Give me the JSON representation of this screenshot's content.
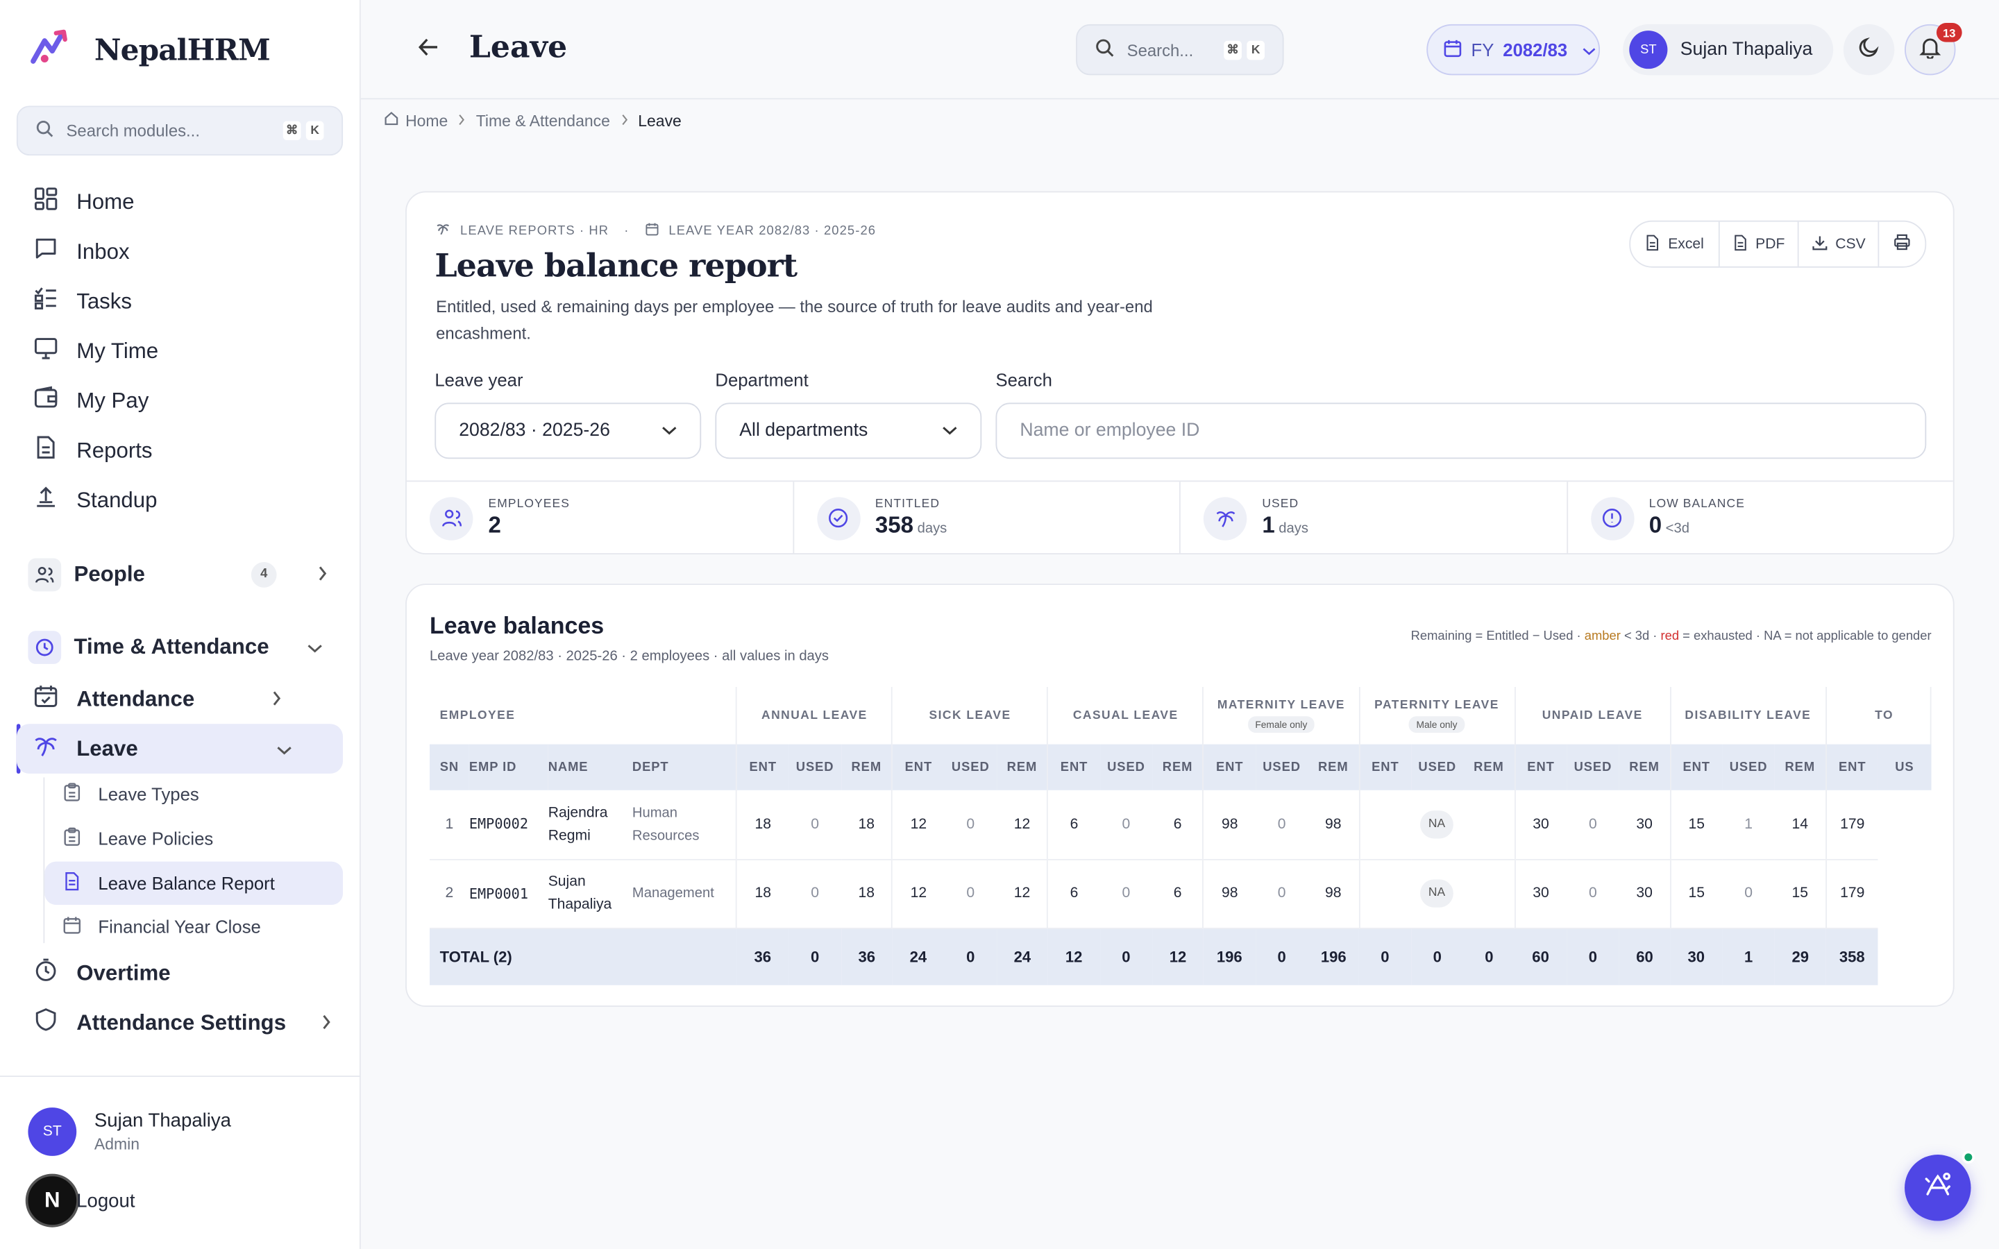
{
  "brand": {
    "name": "NepalHRM"
  },
  "sidebar": {
    "search_placeholder": "Search modules...",
    "kbd1": "⌘",
    "kbd2": "K",
    "items": [
      {
        "label": "Home"
      },
      {
        "label": "Inbox"
      },
      {
        "label": "Tasks"
      },
      {
        "label": "My Time"
      },
      {
        "label": "My Pay"
      },
      {
        "label": "Reports"
      },
      {
        "label": "Standup"
      }
    ],
    "people": {
      "label": "People",
      "count": "4"
    },
    "time_attendance": {
      "label": "Time & Attendance"
    },
    "attendance": {
      "label": "Attendance"
    },
    "leave": {
      "label": "Leave"
    },
    "leave_sub": [
      {
        "label": "Leave Types"
      },
      {
        "label": "Leave Policies"
      },
      {
        "label": "Leave Balance Report"
      },
      {
        "label": "Financial Year Close"
      }
    ],
    "overtime": {
      "label": "Overtime"
    },
    "attendance_settings": {
      "label": "Attendance Settings"
    },
    "user": {
      "initials": "ST",
      "name": "Sujan Thapaliya",
      "role": "Admin"
    },
    "logout": "Logout",
    "n_badge": "N"
  },
  "header": {
    "title": "Leave",
    "search_placeholder": "Search...",
    "kbd1": "⌘",
    "kbd2": "K",
    "fy_prefix": "FY",
    "fy_value": "2082/83",
    "user_initials": "ST",
    "user_name": "Sujan Thapaliya",
    "notifications": "13"
  },
  "breadcrumb": {
    "home": "Home",
    "section": "Time & Attendance",
    "current": "Leave"
  },
  "report": {
    "meta1": "LEAVE REPORTS · HR",
    "meta_sep": "·",
    "meta2": "LEAVE YEAR 2082/83 · 2025-26",
    "title": "Leave balance report",
    "description": "Entitled, used & remaining days per employee — the source of truth for leave audits and year-end encashment.",
    "exports": {
      "excel": "Excel",
      "pdf": "PDF",
      "csv": "CSV"
    },
    "filters": {
      "leave_year_label": "Leave year",
      "leave_year_value": "2082/83 · 2025-26",
      "department_label": "Department",
      "department_value": "All departments",
      "search_label": "Search",
      "search_placeholder": "Name or employee ID"
    },
    "stats": [
      {
        "label": "EMPLOYEES",
        "value": "2",
        "unit": ""
      },
      {
        "label": "ENTITLED",
        "value": "358",
        "unit": "days"
      },
      {
        "label": "USED",
        "value": "1",
        "unit": "days"
      },
      {
        "label": "LOW BALANCE",
        "value": "0",
        "unit": "<3d"
      }
    ]
  },
  "balances": {
    "title": "Leave balances",
    "subtitle": "Leave year 2082/83 · 2025-26 · 2 employees · all values in days",
    "legend": {
      "a": "Remaining = Entitled − Used · ",
      "amber": "amber",
      "b": " < 3d · ",
      "red": "red",
      "c": " = exhausted · NA = not applicable to gender"
    },
    "group_employee": "EMPLOYEE",
    "groups": [
      {
        "name": "ANNUAL LEAVE",
        "tag": ""
      },
      {
        "name": "SICK LEAVE",
        "tag": ""
      },
      {
        "name": "CASUAL LEAVE",
        "tag": ""
      },
      {
        "name": "MATERNITY LEAVE",
        "tag": "Female only"
      },
      {
        "name": "PATERNITY LEAVE",
        "tag": "Male only"
      },
      {
        "name": "UNPAID LEAVE",
        "tag": ""
      },
      {
        "name": "DISABILITY LEAVE",
        "tag": ""
      },
      {
        "name": "TO",
        "tag": ""
      }
    ],
    "cols": {
      "sn": "SN",
      "emp_id": "EMP ID",
      "name": "NAME",
      "dept": "DEPT",
      "ent": "ENT",
      "used": "USED",
      "rem": "REM",
      "us": "US"
    },
    "rows": [
      {
        "sn": "1",
        "id": "EMP0002",
        "name": "Rajendra Regmi",
        "dept": "Human Resources",
        "vals": [
          [
            "18",
            "0",
            "18"
          ],
          [
            "12",
            "0",
            "12"
          ],
          [
            "6",
            "0",
            "6"
          ],
          [
            "98",
            "0",
            "98"
          ],
          [
            "NA"
          ],
          [
            "30",
            "0",
            "30"
          ],
          [
            "15",
            "1",
            "14"
          ],
          [
            "179"
          ]
        ]
      },
      {
        "sn": "2",
        "id": "EMP0001",
        "name": "Sujan Thapaliya",
        "dept": "Management",
        "vals": [
          [
            "18",
            "0",
            "18"
          ],
          [
            "12",
            "0",
            "12"
          ],
          [
            "6",
            "0",
            "6"
          ],
          [
            "98",
            "0",
            "98"
          ],
          [
            "NA"
          ],
          [
            "30",
            "0",
            "30"
          ],
          [
            "15",
            "0",
            "15"
          ],
          [
            "179"
          ]
        ]
      }
    ],
    "total": {
      "label": "TOTAL (2)",
      "vals": [
        [
          "36",
          "0",
          "36"
        ],
        [
          "24",
          "0",
          "24"
        ],
        [
          "12",
          "0",
          "12"
        ],
        [
          "196",
          "0",
          "196"
        ],
        [
          "0",
          "0",
          "0"
        ],
        [
          "60",
          "0",
          "60"
        ],
        [
          "30",
          "1",
          "29"
        ],
        [
          "358"
        ]
      ]
    }
  },
  "colors": {
    "accent": "#4f46e5",
    "danger": "#d22f2f",
    "amber": "#b7791f",
    "online": "#10a36b"
  }
}
